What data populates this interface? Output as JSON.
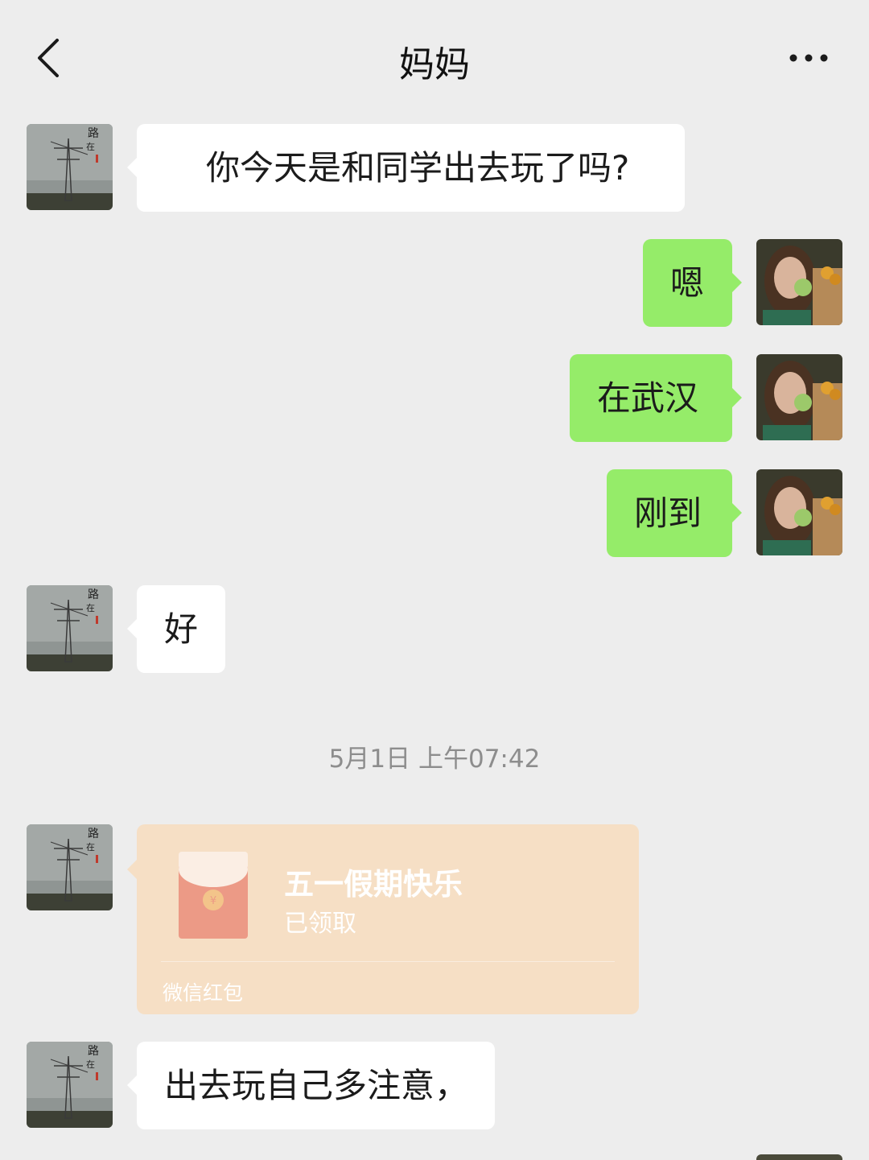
{
  "header": {
    "title": "妈妈",
    "back_icon": "chevron-left-icon",
    "more_icon": "more-dots-icon"
  },
  "messages": [
    {
      "from": "mom",
      "text": "你今天是和同学出去玩了吗?"
    },
    {
      "from": "me",
      "text": "嗯"
    },
    {
      "from": "me",
      "text": "在武汉"
    },
    {
      "from": "me",
      "text": "刚到"
    },
    {
      "from": "mom",
      "text": "好"
    },
    {
      "from": "mom",
      "text": "出去玩自己多注意，"
    }
  ],
  "timestamp": "5月1日 上午07:42",
  "red_packet": {
    "title": "五一假期快乐",
    "status": "已领取",
    "footer": "微信红包",
    "icon": "red-envelope-icon",
    "background": "#f6dfc5"
  },
  "colors": {
    "background": "#ededed",
    "incoming_bubble": "#ffffff",
    "outgoing_bubble": "#95ec69"
  }
}
